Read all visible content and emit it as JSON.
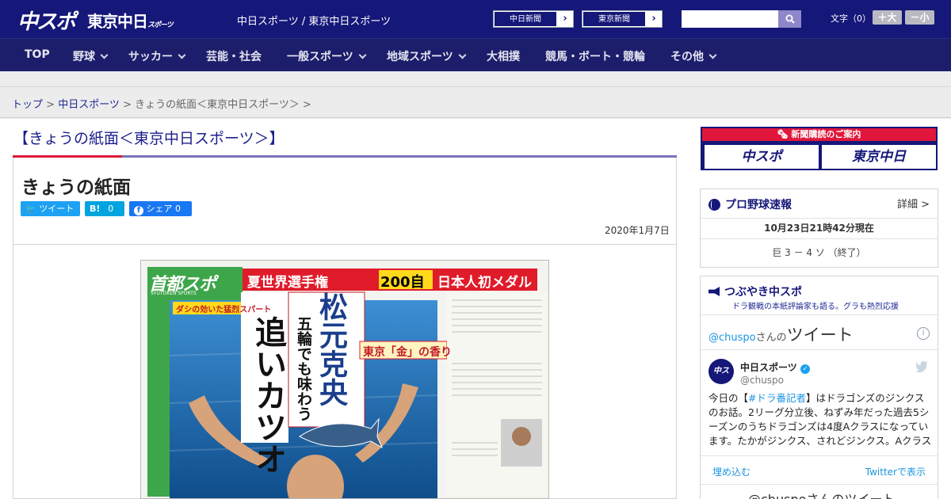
{
  "header": {
    "logo_chuspo": "中スポ",
    "logo_tokyo": "東京中日",
    "logo_tokyo_small": "スポーツ",
    "site_name": "中日スポーツ / 東京中日スポーツ",
    "link_chunichi": "中日新聞",
    "link_tokyo": "東京新聞",
    "link_arrow": "›",
    "search_placeholder": "",
    "fontsize_label": "文字（0）",
    "font_larger": "＋大",
    "font_smaller": "－小"
  },
  "nav": {
    "items": [
      {
        "label": "TOP"
      },
      {
        "label": "野球"
      },
      {
        "label": "サッカー"
      },
      {
        "label": "芸能・社会"
      },
      {
        "label": "一般スポーツ"
      },
      {
        "label": "地域スポーツ"
      },
      {
        "label": "大相撲"
      },
      {
        "label": "競馬・ボート・競輪"
      },
      {
        "label": "その他"
      }
    ]
  },
  "breadcrumb": {
    "top": "トップ",
    "sep": " > ",
    "chunichi": "中日スポーツ",
    "current": "きょうの紙面＜東京中日スポーツ＞",
    "tail": " >"
  },
  "page": {
    "title": "【きょうの紙面＜東京中日スポーツ＞】",
    "heading": "きょうの紙面",
    "date": "2020年1月7日"
  },
  "social": {
    "tweet": "ツイート",
    "hatena": "B!",
    "hatena_count": "0",
    "share": "シェア",
    "share_count": "0"
  },
  "paper": {
    "brand": "首都スポ",
    "brand_en": "SYUTOKEN SPORTS",
    "headline_top": "夏世界選手権",
    "headline_200": "200自",
    "headline_medal": "日本人初メダル",
    "name": "松元克央",
    "sub1": "五輪でも味わう",
    "sub2": "追いカツオ",
    "tag_gold": "東京「金」の香り",
    "kicker": "ダシの効いた猛烈スパート"
  },
  "sidebar": {
    "ad_title": "新聞購読のご案内",
    "ad_logo1": "中スポ",
    "ad_logo2": "東京中日",
    "baseball_title": "プロ野球速報",
    "baseball_detail": "詳細 >",
    "baseball_time": "10月23日21時42分現在",
    "baseball_score": "巨 3 － 4 ソ （終了）",
    "tsubuyaki_title": "つぶやき中スポ",
    "tsubuyaki_sub": "ドラ観戦の本紙評論家も語る。グラも熱烈応援",
    "tweets_by_handle": "@chuspo",
    "tweets_by_suffix": "さんの",
    "tweets_by_title": "ツイート",
    "info_icon": "i",
    "tweet_name": "中日スポーツ",
    "tweet_handle": "@chuspo",
    "tweet_text_1": "今日の【",
    "tweet_hashtag": "#ドラ番記者",
    "tweet_text_2": "】はドラゴンズのジンクスのお話。2リーグ分立後、ねずみ年だった過去5シーズンのうちドラゴンズは4度Aクラスになっています。たかがジンクス、されどジンクス。Aクラス達成実",
    "embed": "埋め込む",
    "view_on_twitter": "Twitterで表示",
    "bottom_tweets": "@chuspoさんのツイート"
  },
  "colors": {
    "header_bg": "#151779",
    "nav_bg": "#1c1e6b",
    "accent_red": "#e0173a",
    "link_blue": "#1f2a92",
    "twitter_blue": "#1da1f2",
    "hatena_blue": "#00a4de",
    "facebook_blue": "#1877f2"
  }
}
